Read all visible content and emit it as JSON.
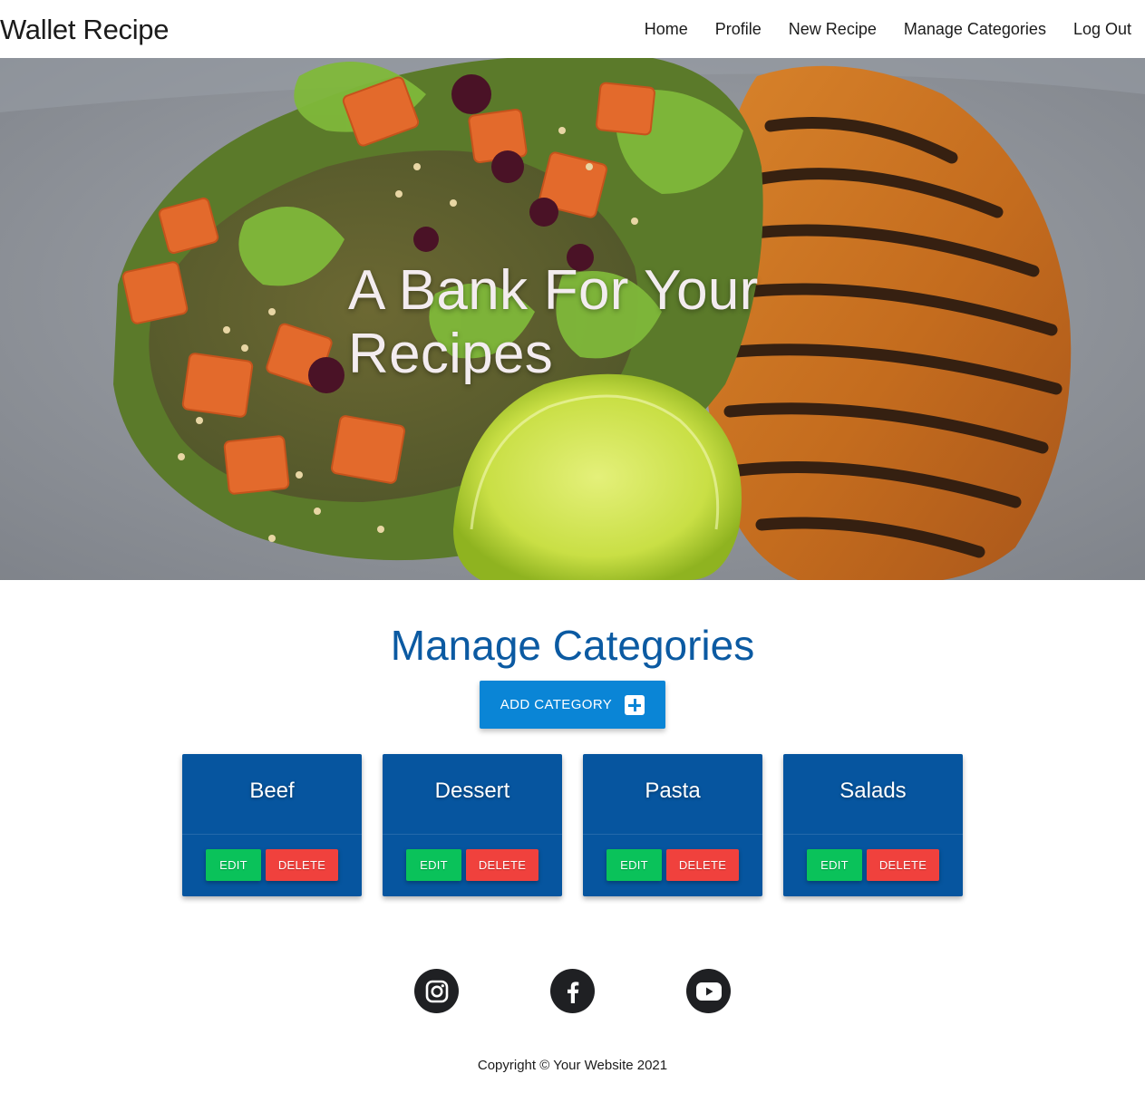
{
  "navbar": {
    "brand": "Wallet Recipe",
    "links": [
      {
        "label": "Home"
      },
      {
        "label": "Profile"
      },
      {
        "label": "New Recipe"
      },
      {
        "label": "Manage Categories"
      },
      {
        "label": "Log Out"
      }
    ]
  },
  "hero": {
    "title": "A Bank For Your Recipes"
  },
  "main": {
    "title": "Manage Categories",
    "add_button_label": "ADD CATEGORY",
    "add_button_icon": "plus-square-icon",
    "categories": [
      {
        "name": "Beef",
        "edit_label": "EDIT",
        "delete_label": "DELETE"
      },
      {
        "name": "Dessert",
        "edit_label": "EDIT",
        "delete_label": "DELETE"
      },
      {
        "name": "Pasta",
        "edit_label": "EDIT",
        "delete_label": "DELETE"
      },
      {
        "name": "Salads",
        "edit_label": "EDIT",
        "delete_label": "DELETE"
      }
    ]
  },
  "footer": {
    "socials": [
      {
        "icon": "instagram-icon"
      },
      {
        "icon": "facebook-icon"
      },
      {
        "icon": "youtube-icon"
      }
    ],
    "copyright": "Copyright © Your Website 2021"
  },
  "colors": {
    "heading_blue": "#0b5aa2",
    "card_blue": "#06559f",
    "button_blue": "#0a85d6",
    "edit_green": "#0ac25a",
    "delete_red": "#f0413d",
    "social_dark": "#1f2023"
  }
}
